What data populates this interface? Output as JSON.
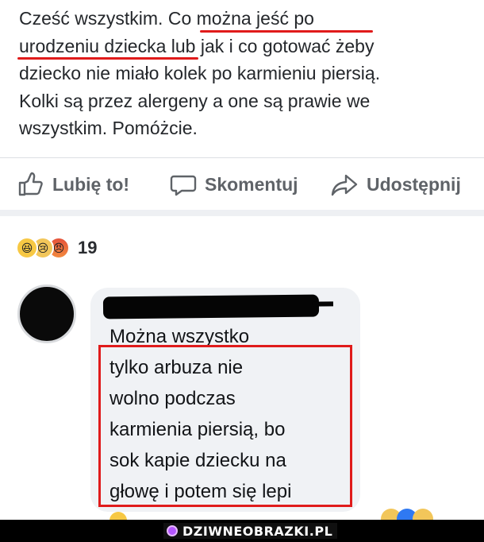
{
  "post": {
    "lines": [
      "Cześć wszystkim. Co można jeść po",
      "urodzeniu dziecka lub jak i co gotować żeby",
      "dziecko nie miało kolek po karmieniu piersią.",
      "Kolki są przez alergeny a one są prawie we",
      "wszystkim. Pomóżcie."
    ]
  },
  "actions": {
    "like_label": "Lubię to!",
    "comment_label": "Skomentuj",
    "share_label": "Udostępnij"
  },
  "reactions": {
    "icons": [
      "haha-reaction-icon",
      "sad-reaction-icon",
      "angry-reaction-icon"
    ],
    "count": "19"
  },
  "comment": {
    "lines": [
      "Można wszystko",
      "tylko arbuza nie",
      "wolno podczas",
      "karmienia piersią, bo",
      "sok kapie dziecku na",
      "głowę i potem się lepi"
    ]
  },
  "watermark": {
    "text": "DZIWNEOBRAZKI.PL"
  },
  "colors": {
    "highlight_red": "#e01b1b",
    "bubble_bg": "#f0f2f5",
    "action_gray": "#5f6368"
  }
}
